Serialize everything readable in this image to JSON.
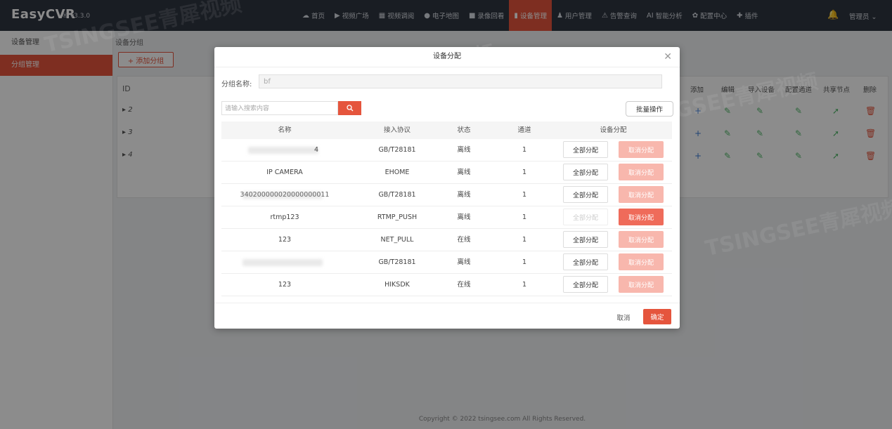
{
  "app": {
    "name": "EasyCVR",
    "version": "® v3.3.0"
  },
  "nav": [
    {
      "label": "首页",
      "icon": "home-icon",
      "glyph": "☁",
      "active": false
    },
    {
      "label": "视频广场",
      "icon": "play-icon",
      "glyph": "▶",
      "active": false
    },
    {
      "label": "视频调阅",
      "icon": "grid-icon",
      "glyph": "▦",
      "active": false
    },
    {
      "label": "电子地图",
      "icon": "map-pin-icon",
      "glyph": "●",
      "active": false
    },
    {
      "label": "录像回看",
      "icon": "video-camera-icon",
      "glyph": "■",
      "active": false
    },
    {
      "label": "设备管理",
      "icon": "bars-icon",
      "glyph": "▮",
      "active": true
    },
    {
      "label": "用户管理",
      "icon": "user-icon",
      "glyph": "♟",
      "active": false
    },
    {
      "label": "告警查询",
      "icon": "alarm-icon",
      "glyph": "⚠",
      "active": false
    },
    {
      "label": "智能分析",
      "icon": "ai-icon",
      "glyph": "AI",
      "active": false
    },
    {
      "label": "配置中心",
      "icon": "gear-icon",
      "glyph": "✿",
      "active": false
    },
    {
      "label": "插件",
      "icon": "puzzle-icon",
      "glyph": "✚",
      "active": false
    }
  ],
  "header": {
    "admin_label": "管理员 ⌄"
  },
  "sidebar": {
    "items": [
      {
        "label": "设备管理"
      },
      {
        "label": "分组管理"
      }
    ]
  },
  "main": {
    "breadcrumb": "设备分组",
    "add_group_label": "+ 添加分组",
    "table_id_header": "ID",
    "row_ids": [
      "▸ 2",
      "▸ 3",
      "▸ 4"
    ],
    "columns": [
      "添加",
      "编辑",
      "导入设备",
      "配置通道",
      "共享节点",
      "删除"
    ]
  },
  "footer": "Copyright © 2022 tsingsee.com All Rights Reserved.",
  "watermark": "TSINGSEE青犀视频",
  "modal": {
    "title": "设备分配",
    "group_name_label": "分组名称:",
    "group_name_value": "bf",
    "search_placeholder": "请输入搜索内容",
    "batch_label": "批量操作",
    "headers": [
      "名称",
      "接入协议",
      "状态",
      "通道",
      "设备分配"
    ],
    "assign_all_label": "全部分配",
    "cancel_assign_label": "取消分配",
    "rows": [
      {
        "name": "4",
        "protocol": "GB/T28181",
        "status": "离线",
        "channels": "1",
        "assign_disabled": false,
        "cancel_active": false
      },
      {
        "name": "IP CAMERA",
        "protocol": "EHOME",
        "status": "离线",
        "channels": "1",
        "assign_disabled": false,
        "cancel_active": false
      },
      {
        "name": "340200000020000000011",
        "protocol": "GB/T28181",
        "status": "离线",
        "channels": "1",
        "assign_disabled": false,
        "cancel_active": false
      },
      {
        "name": "rtmp123",
        "protocol": "RTMP_PUSH",
        "status": "离线",
        "channels": "1",
        "assign_disabled": true,
        "cancel_active": true
      },
      {
        "name": "123",
        "protocol": "NET_PULL",
        "status": "在线",
        "channels": "1",
        "assign_disabled": false,
        "cancel_active": false
      },
      {
        "name": "",
        "protocol": "GB/T28181",
        "status": "离线",
        "channels": "1",
        "assign_disabled": false,
        "cancel_active": false
      },
      {
        "name": "123",
        "protocol": "HIKSDK",
        "status": "在线",
        "channels": "1",
        "assign_disabled": false,
        "cancel_active": false
      }
    ],
    "cancel_label": "取消",
    "ok_label": "确定"
  },
  "colors": {
    "accent": "#e5553d",
    "topbar": "#2f3540",
    "cancel_light": "#f8b7ad",
    "cancel_strong": "#ef6b5a"
  }
}
